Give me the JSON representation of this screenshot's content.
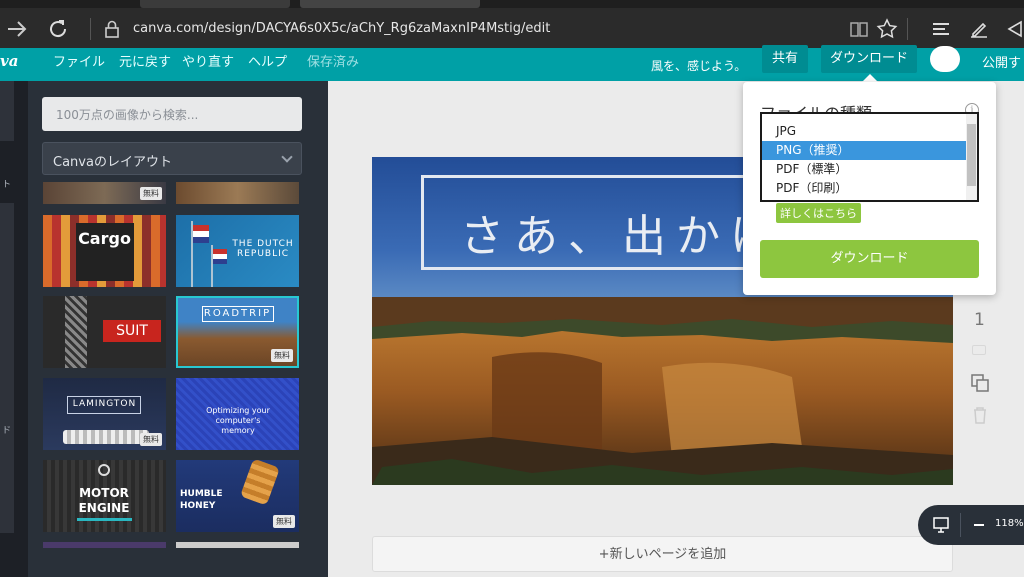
{
  "browser": {
    "url": "canva.com/design/DACYA6s0X5c/aChY_Rg6zaMaxnIP4Mstig/edit",
    "icons": [
      "forward-arrow-icon",
      "refresh-icon",
      "lock-icon",
      "reading-view-icon",
      "favorite-star-icon",
      "hub-icon",
      "web-note-icon",
      "share-icon"
    ]
  },
  "topbar": {
    "logo": "va",
    "menu": [
      "ファイル",
      "元に戻す",
      "やり直す",
      "ヘルプ",
      "保存済み"
    ],
    "tagline": "風を、感じよう。",
    "share_label": "共有",
    "download_label": "ダウンロード",
    "publish_label": "公開す"
  },
  "leftstrip": {
    "labels": [
      "ト",
      "ド"
    ]
  },
  "sidepanel": {
    "search_placeholder": "100万点の画像から検索...",
    "layout_select": "Canvaのレイアウト",
    "free_badge": "無料",
    "thumbs": [
      {
        "title": "Cargo"
      },
      {
        "title": "THE DUTCH REPUBLIC"
      },
      {
        "title": "SUIT"
      },
      {
        "title": "ROADTRIP"
      },
      {
        "title": "LAMINGTON"
      },
      {
        "title": "Optimizing your computer's memory"
      },
      {
        "title": "MOTOR ENGINE"
      },
      {
        "title": "HUMBLE HONEY"
      }
    ]
  },
  "canvas": {
    "title_text": "さあ、出かけよう",
    "page_number": "1",
    "add_page": "+新しいページを追加",
    "zoom": "118%"
  },
  "download_popup": {
    "file_type_label": "ファイルの種類",
    "options": [
      "JPG",
      "PNG（推奨）",
      "PDF（標準）",
      "PDF（印刷）"
    ],
    "selected": "PNG（推奨）",
    "learn_more": "詳しくはこちら",
    "download_button": "ダウンロード"
  },
  "colors": {
    "teal": "#00a0a6",
    "green": "#8dc63f",
    "panel": "#293039",
    "select_blue": "#3a96dd"
  }
}
